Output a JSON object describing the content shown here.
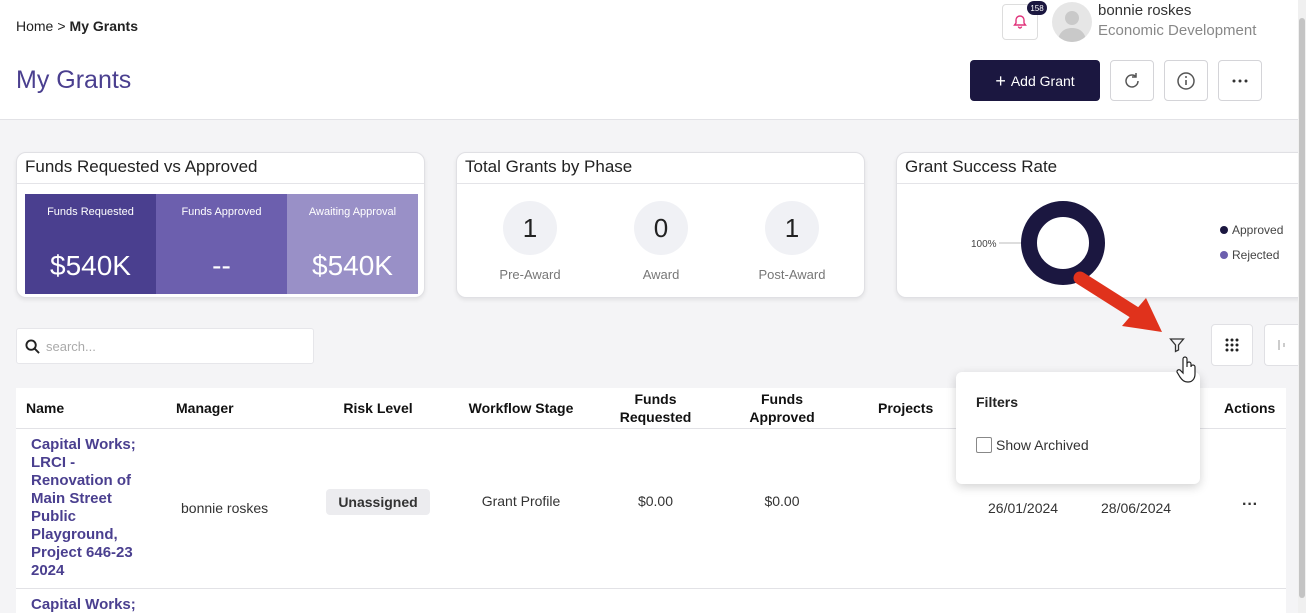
{
  "breadcrumb": {
    "home": "Home",
    "separator": ">",
    "current": "My Grants"
  },
  "page_title": "My Grants",
  "user": {
    "name": "bonnie roskes",
    "department": "Economic Development",
    "notification_count": "158"
  },
  "header_actions": {
    "add_grant": "Add Grant"
  },
  "cards": {
    "funds": {
      "title": "Funds Requested vs Approved",
      "cells": [
        {
          "label": "Funds Requested",
          "value": "$540K",
          "color": "#4a3f8f"
        },
        {
          "label": "Funds Approved",
          "value": "--",
          "color": "#6c5fae"
        },
        {
          "label": "Awaiting Approval",
          "value": "$540K",
          "color": "#9990c7"
        }
      ]
    },
    "phases": {
      "title": "Total Grants by Phase",
      "items": [
        {
          "count": "1",
          "label": "Pre-Award"
        },
        {
          "count": "0",
          "label": "Award"
        },
        {
          "count": "1",
          "label": "Post-Award"
        }
      ]
    },
    "success": {
      "title": "Grant Success Rate",
      "pct_label": "100%",
      "legend": [
        {
          "label": "Approved",
          "color": "#1b1740"
        },
        {
          "label": "Rejected",
          "color": "#6c5fae"
        }
      ]
    }
  },
  "search": {
    "placeholder": "search..."
  },
  "table": {
    "headers": {
      "name": "Name",
      "manager": "Manager",
      "risk": "Risk Level",
      "workflow": "Workflow Stage",
      "funds_requested": "Funds Requested",
      "funds_approved": "Funds Approved",
      "projects": "Projects",
      "actions": "Actions"
    },
    "rows": [
      {
        "name": "Capital Works; LRCI - Renovation of Main Street Public Playground, Project 646-23 2024",
        "manager": "bonnie roskes",
        "risk": "Unassigned",
        "workflow": "Grant Profile",
        "funds_requested": "$0.00",
        "funds_approved": "$0.00",
        "start_date": "26/01/2024",
        "end_date": "28/06/2024",
        "actions": "···"
      },
      {
        "name": "Capital Works;"
      }
    ]
  },
  "filters": {
    "title": "Filters",
    "show_archived": "Show Archived"
  },
  "colors": {
    "brand": "#4a3f8f",
    "dark": "#1b1740",
    "arrow": "#e0321c"
  }
}
